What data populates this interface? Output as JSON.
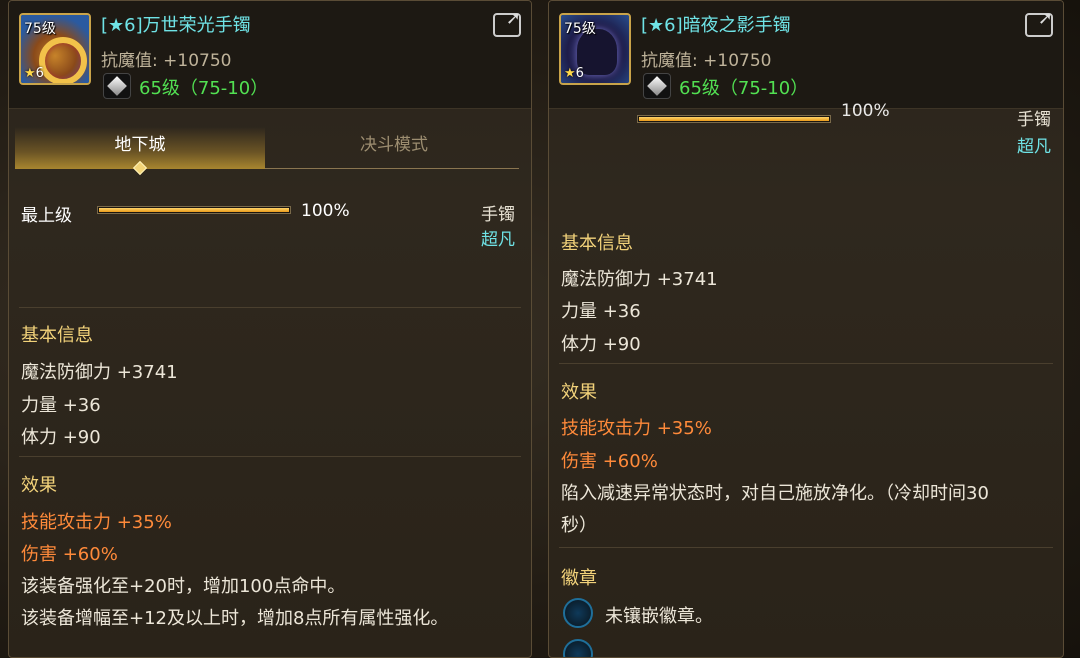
{
  "left": {
    "level_tag": "75级",
    "star_count": "6",
    "title_prefix": "[★6]",
    "title_name": "万世荣光手镯",
    "stat_line": "抗魔值: +10750",
    "level_range": "65级（75-10）",
    "tabs": [
      "地下城",
      "决斗模式"
    ],
    "grade_label": "最上级",
    "grade_percent": "100%",
    "grade_value": 100,
    "slot": "手镯",
    "rarity": "超凡",
    "basic_title": "基本信息",
    "basic_lines": [
      "魔法防御力 +3741",
      "力量 +36",
      "体力 +90"
    ],
    "effect_title": "效果",
    "effect_orange": [
      "技能攻击力 +35%",
      "伤害 +60%"
    ],
    "effect_lines": [
      "该装备强化至+20时，增加100点命中。",
      "该装备增幅至+12及以上时，增加8点所有属性强化。"
    ]
  },
  "right": {
    "level_tag": "75级",
    "star_count": "6",
    "title_prefix": "[★6]",
    "title_name": "暗夜之影手镯",
    "stat_line": "抗魔值: +10750",
    "level_range": "65级（75-10）",
    "grade_percent": "100%",
    "slot": "手镯",
    "rarity": "超凡",
    "basic_title": "基本信息",
    "basic_lines": [
      "魔法防御力 +3741",
      "力量 +36",
      "体力 +90"
    ],
    "effect_title": "效果",
    "effect_orange": [
      "技能攻击力 +35%",
      "伤害 +60%"
    ],
    "effect_lines": [
      "陷入减速异常状态时，对自己施放净化。（冷却时间30",
      "秒）"
    ],
    "emblem_title": "徽章",
    "emblem_empty": "未镶嵌徽章。"
  },
  "colors": {
    "title": "#6fe3e6",
    "level": "#52e052",
    "section": "#f2d27a",
    "effect": "#ff8a3a",
    "frame": "#c9a44a"
  },
  "icons": [
    "bracelet-item-icon",
    "shadow-bracelet-item-icon",
    "diamond-gem-icon",
    "share-icon",
    "emblem-slot-icon"
  ]
}
